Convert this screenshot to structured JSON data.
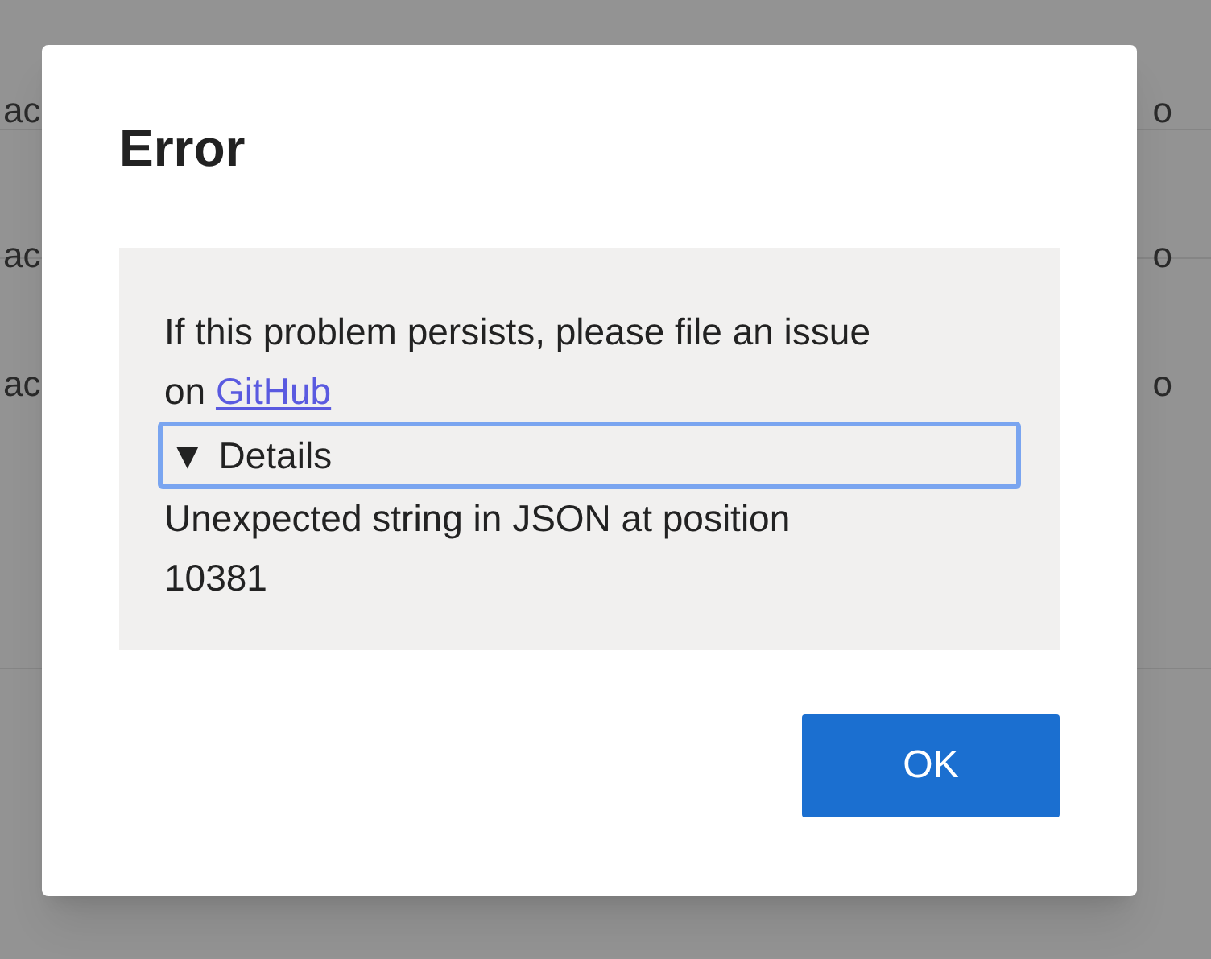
{
  "background": {
    "left_fragments": [
      "ac",
      "ac",
      "ac"
    ],
    "right_fragments": [
      "o",
      "o",
      "o"
    ]
  },
  "dialog": {
    "title": "Error",
    "message": "If this problem persists, please file an issue on",
    "link": "GitHub",
    "details": {
      "marker": "▼",
      "label": "Details",
      "expanded": true,
      "focused": true,
      "text": "Unexpected string in JSON at position 10381"
    },
    "button": "OK"
  }
}
